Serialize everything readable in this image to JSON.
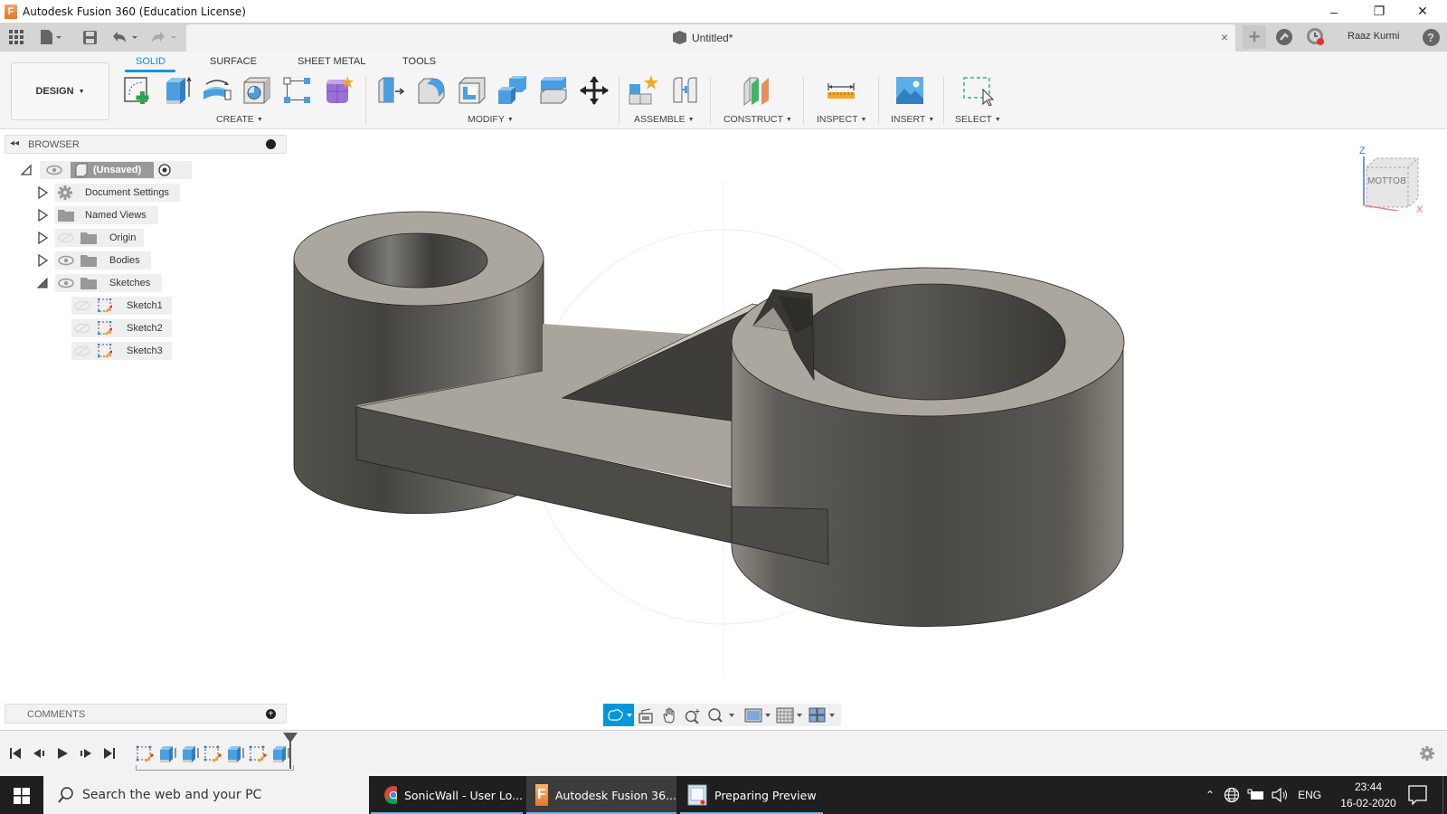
{
  "window": {
    "title": "Autodesk Fusion 360 (Education License)",
    "minimize": "–",
    "restore": "❐",
    "close": "✕"
  },
  "quick_access": {
    "document_tab": "Untitled*",
    "tab_close": "×",
    "new_tab": "+",
    "user_name": "Raaz Kurmi",
    "help": "?"
  },
  "ribbon": {
    "workspace": "DESIGN",
    "tabs": [
      {
        "label": "SOLID",
        "active": true
      },
      {
        "label": "SURFACE",
        "active": false
      },
      {
        "label": "SHEET METAL",
        "active": false
      },
      {
        "label": "TOOLS",
        "active": false
      }
    ],
    "groups": [
      {
        "label": "CREATE",
        "tools": [
          "create-sketch",
          "extrude",
          "revolve",
          "hole",
          "rectangular-pattern",
          "create-form"
        ]
      },
      {
        "label": "MODIFY",
        "tools": [
          "press-pull",
          "fillet",
          "shell",
          "combine",
          "split-body",
          "move-copy"
        ]
      },
      {
        "label": "ASSEMBLE",
        "tools": [
          "new-component",
          "joint"
        ]
      },
      {
        "label": "CONSTRUCT",
        "tools": [
          "offset-plane"
        ]
      },
      {
        "label": "INSPECT",
        "tools": [
          "measure"
        ]
      },
      {
        "label": "INSERT",
        "tools": [
          "insert-image"
        ]
      },
      {
        "label": "SELECT",
        "tools": [
          "window-select"
        ]
      }
    ]
  },
  "browser": {
    "title": "BROWSER",
    "items": [
      {
        "label": "(Unsaved)",
        "level": 0,
        "expanded": true,
        "visible": true
      },
      {
        "label": "Document Settings",
        "level": 1,
        "expanded": false
      },
      {
        "label": "Named Views",
        "level": 1,
        "expanded": false
      },
      {
        "label": "Origin",
        "level": 1,
        "expanded": false,
        "visible": false
      },
      {
        "label": "Bodies",
        "level": 1,
        "expanded": false,
        "visible": true
      },
      {
        "label": "Sketches",
        "level": 1,
        "expanded": true,
        "visible": true
      },
      {
        "label": "Sketch1",
        "level": 2,
        "visible": false
      },
      {
        "label": "Sketch2",
        "level": 2,
        "visible": false
      },
      {
        "label": "Sketch3",
        "level": 2,
        "visible": false
      }
    ]
  },
  "viewcube": {
    "face": "BOTTOM",
    "axis_z": "Z",
    "axis_x": "X"
  },
  "comments": {
    "title": "COMMENTS"
  },
  "navbar": {
    "tools": [
      "orbit",
      "look-at",
      "pan",
      "zoom",
      "fit",
      "display-settings",
      "grid-snaps",
      "viewports"
    ]
  },
  "timeline": {
    "features": [
      "sketch",
      "extrude",
      "extrude",
      "sketch",
      "extrude",
      "sketch",
      "extrude"
    ]
  },
  "taskbar": {
    "search_placeholder": "Search the web and your PC",
    "apps": [
      {
        "label": "SonicWall - User Lo...",
        "active": false
      },
      {
        "label": "Autodesk Fusion 36...",
        "active": true
      },
      {
        "label": "Preparing Preview",
        "active": false
      }
    ],
    "language": "ENG",
    "time": "23:44",
    "date": "16-02-2020"
  },
  "colors": {
    "accent": "#0696d7",
    "model_top": "#aaa69c",
    "model_side": "#4c4a45",
    "taskbar": "#1f1f1f"
  }
}
